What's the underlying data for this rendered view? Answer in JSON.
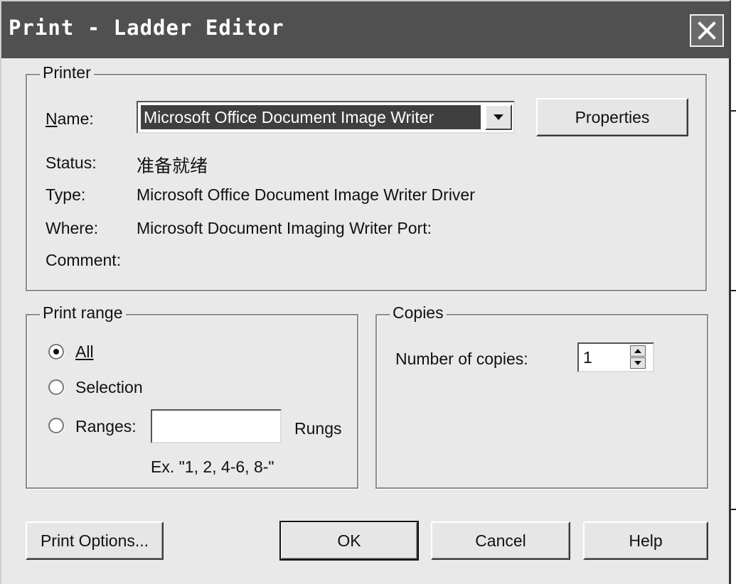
{
  "window": {
    "title": "Print - Ladder Editor",
    "close_icon": "close-icon"
  },
  "printer": {
    "legend": "Printer",
    "name_label": "Name:",
    "name_value": "Microsoft Office Document Image Writer",
    "properties_button": "Properties",
    "status_label": "Status:",
    "status_value": "准备就绪",
    "type_label": "Type:",
    "type_value": "Microsoft Office Document Image Writer Driver",
    "where_label": "Where:",
    "where_value": "Microsoft Document Imaging Writer Port:",
    "comment_label": "Comment:",
    "comment_value": ""
  },
  "print_range": {
    "legend": "Print range",
    "options": [
      {
        "label": "All",
        "selected": true
      },
      {
        "label": "Selection",
        "selected": false
      },
      {
        "label": "Ranges:",
        "selected": false
      }
    ],
    "ranges_value": "",
    "ranges_unit": "Rungs",
    "example": "Ex. \"1, 2, 4-6, 8-\""
  },
  "copies": {
    "legend": "Copies",
    "label": "Number of copies:",
    "value": "1"
  },
  "buttons": {
    "print_options": "Print Options...",
    "ok": "OK",
    "cancel": "Cancel",
    "help": "Help"
  }
}
